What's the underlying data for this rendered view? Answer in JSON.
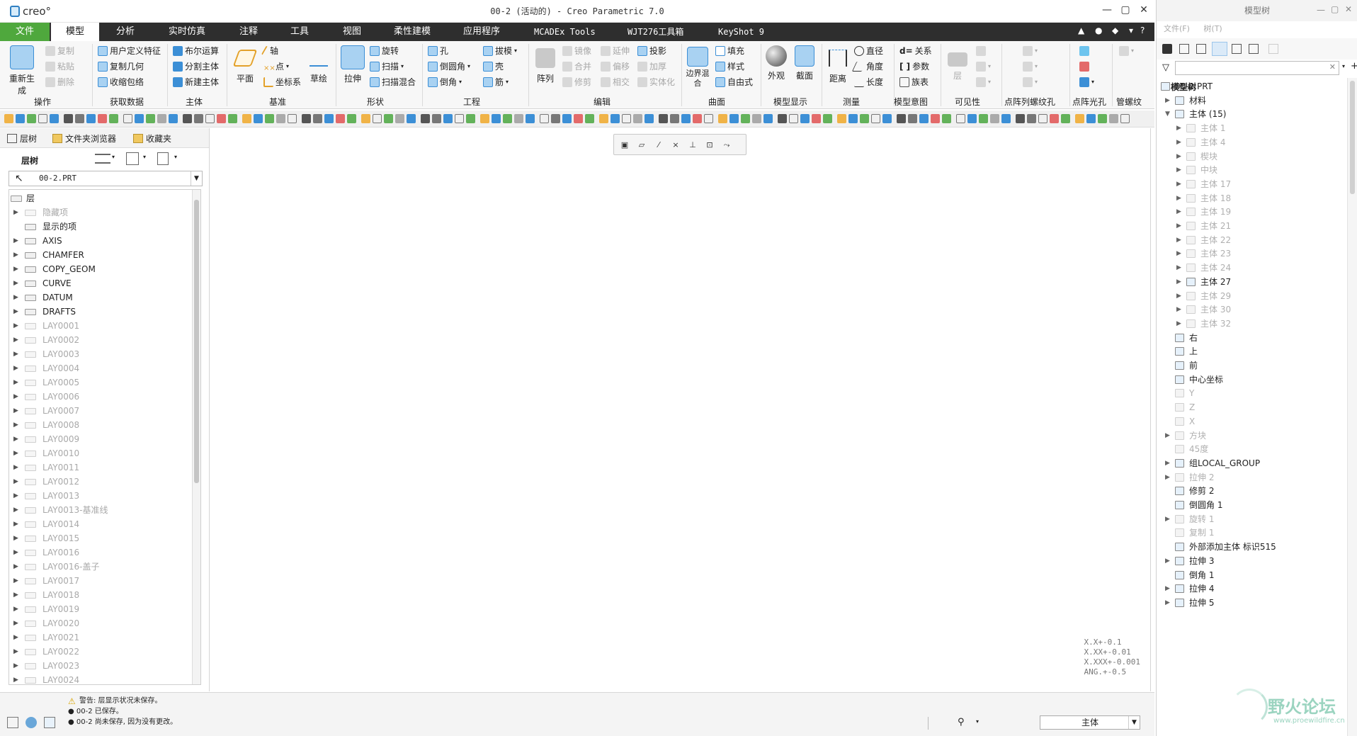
{
  "app": {
    "logo_text": "creo°",
    "window_title": "00-2 (活动的) - Creo Parametric 7.0"
  },
  "menu_tabs": [
    "文件",
    "模型",
    "分析",
    "实时仿真",
    "注释",
    "工具",
    "视图",
    "柔性建模",
    "应用程序",
    "MCADEx Tools",
    "WJT276工具箱",
    "KeyShot 9"
  ],
  "ribbon": {
    "groups": [
      "操作",
      "获取数据",
      "主体",
      "基准",
      "形状",
      "工程",
      "编辑",
      "曲面",
      "模型显示",
      "测量",
      "模型意图",
      "可见性",
      "点阵列螺纹孔",
      "点阵光孔",
      "管螺纹"
    ],
    "regenerate": "重新生成",
    "copy": "复制",
    "paste": "粘贴",
    "delete": "删除",
    "user_feature": "用户定义特征",
    "copy_geom": "复制几何",
    "shrinkwrap": "收缩包络",
    "boolean": "布尔运算",
    "split_body": "分割主体",
    "new_body": "新建主体",
    "plane": "平面",
    "axis": "轴",
    "point": "点",
    "csys": "坐标系",
    "sketch": "草绘",
    "extrude": "拉伸",
    "revolve": "旋转",
    "sweep": "扫描",
    "swept_blend": "扫描混合",
    "hole": "孔",
    "round": "倒圆角",
    "chamfer": "倒角",
    "draft": "拔模",
    "shell": "壳",
    "rib": "筋",
    "pattern": "阵列",
    "mirror": "镜像",
    "merge": "合并",
    "trim": "修剪",
    "extend": "延伸",
    "offset": "偏移",
    "intersect": "相交",
    "project": "投影",
    "thicken": "加厚",
    "solidify": "实体化",
    "boundary_blend": "边界混合",
    "fill": "填充",
    "style": "样式",
    "freestyle": "自由式",
    "appearance": "外观",
    "section": "截面",
    "distance": "距离",
    "diameter": "直径",
    "angle": "角度",
    "length": "长度",
    "relations": "关系",
    "parameters": "参数",
    "family_table": "族表",
    "layer": "层",
    "relations_prefix": "d="
  },
  "left_panel": {
    "tabs": [
      "层树",
      "文件夹浏览器",
      "收藏夹"
    ],
    "header": "层树",
    "selected_part": "00-2.PRT",
    "layers": [
      {
        "name": "层",
        "dim": false,
        "exp": false,
        "root": true
      },
      {
        "name": "隐藏项",
        "dim": true,
        "exp": true
      },
      {
        "name": "显示的项",
        "dim": false,
        "exp": false
      },
      {
        "name": "AXIS",
        "dim": false,
        "exp": true
      },
      {
        "name": "CHAMFER",
        "dim": false,
        "exp": true
      },
      {
        "name": "COPY_GEOM",
        "dim": false,
        "exp": true
      },
      {
        "name": "CURVE",
        "dim": false,
        "exp": true
      },
      {
        "name": "DATUM",
        "dim": false,
        "exp": true
      },
      {
        "name": "DRAFTS",
        "dim": false,
        "exp": true
      },
      {
        "name": "LAY0001",
        "dim": true,
        "exp": true
      },
      {
        "name": "LAY0002",
        "dim": true,
        "exp": true
      },
      {
        "name": "LAY0003",
        "dim": true,
        "exp": true
      },
      {
        "name": "LAY0004",
        "dim": true,
        "exp": true
      },
      {
        "name": "LAY0005",
        "dim": true,
        "exp": true
      },
      {
        "name": "LAY0006",
        "dim": true,
        "exp": true
      },
      {
        "name": "LAY0007",
        "dim": true,
        "exp": true
      },
      {
        "name": "LAY0008",
        "dim": true,
        "exp": true
      },
      {
        "name": "LAY0009",
        "dim": true,
        "exp": true
      },
      {
        "name": "LAY0010",
        "dim": true,
        "exp": true
      },
      {
        "name": "LAY0011",
        "dim": true,
        "exp": true
      },
      {
        "name": "LAY0012",
        "dim": true,
        "exp": true
      },
      {
        "name": "LAY0013",
        "dim": true,
        "exp": true
      },
      {
        "name": "LAY0013-基准线",
        "dim": true,
        "exp": true
      },
      {
        "name": "LAY0014",
        "dim": true,
        "exp": true
      },
      {
        "name": "LAY0015",
        "dim": true,
        "exp": true
      },
      {
        "name": "LAY0016",
        "dim": true,
        "exp": true
      },
      {
        "name": "LAY0016-盖子",
        "dim": true,
        "exp": true
      },
      {
        "name": "LAY0017",
        "dim": true,
        "exp": true
      },
      {
        "name": "LAY0018",
        "dim": true,
        "exp": true
      },
      {
        "name": "LAY0019",
        "dim": true,
        "exp": true
      },
      {
        "name": "LAY0020",
        "dim": true,
        "exp": true
      },
      {
        "name": "LAY0021",
        "dim": true,
        "exp": true
      },
      {
        "name": "LAY0022",
        "dim": true,
        "exp": true
      },
      {
        "name": "LAY0023",
        "dim": true,
        "exp": true
      },
      {
        "name": "LAY0024",
        "dim": true,
        "exp": true
      }
    ]
  },
  "graphics": {
    "tolerance_lines": [
      "X.X+-0.1",
      "X.XX+-0.01",
      "X.XXX+-0.001",
      "ANG.+-0.5"
    ]
  },
  "status": {
    "messages": [
      "警告: 层显示状况未保存。",
      "● 00-2 已保存。",
      "● 00-2 尚未保存, 因为没有更改。"
    ],
    "filter_value": "主体"
  },
  "model_tree": {
    "window_title": "模型树",
    "menu": [
      "文件(F)",
      "树(T)"
    ],
    "header": "模型树",
    "items": [
      {
        "name": "00-2.PRT",
        "level": 0,
        "exp": false,
        "dim": false
      },
      {
        "name": "材料",
        "level": 1,
        "exp": true,
        "dim": false
      },
      {
        "name": "主体 (15)",
        "level": 1,
        "exp": true,
        "dim": false,
        "open": true
      },
      {
        "name": "主体 1",
        "level": 2,
        "exp": true,
        "dim": true
      },
      {
        "name": "主体 4",
        "level": 2,
        "exp": true,
        "dim": true
      },
      {
        "name": "楔块",
        "level": 2,
        "exp": true,
        "dim": true
      },
      {
        "name": "中块",
        "level": 2,
        "exp": true,
        "dim": true
      },
      {
        "name": "主体 17",
        "level": 2,
        "exp": true,
        "dim": true
      },
      {
        "name": "主体 18",
        "level": 2,
        "exp": true,
        "dim": true
      },
      {
        "name": "主体 19",
        "level": 2,
        "exp": true,
        "dim": true
      },
      {
        "name": "主体 21",
        "level": 2,
        "exp": true,
        "dim": true
      },
      {
        "name": "主体 22",
        "level": 2,
        "exp": true,
        "dim": true
      },
      {
        "name": "主体 23",
        "level": 2,
        "exp": true,
        "dim": true
      },
      {
        "name": "主体 24",
        "level": 2,
        "exp": true,
        "dim": true
      },
      {
        "name": "主体 27",
        "level": 2,
        "exp": true,
        "dim": false
      },
      {
        "name": "主体 29",
        "level": 2,
        "exp": true,
        "dim": true
      },
      {
        "name": "主体 30",
        "level": 2,
        "exp": true,
        "dim": true
      },
      {
        "name": "主体 32",
        "level": 2,
        "exp": true,
        "dim": true
      },
      {
        "name": "右",
        "level": 1,
        "exp": false,
        "dim": false
      },
      {
        "name": "上",
        "level": 1,
        "exp": false,
        "dim": false
      },
      {
        "name": "前",
        "level": 1,
        "exp": false,
        "dim": false
      },
      {
        "name": "中心坐标",
        "level": 1,
        "exp": false,
        "dim": false
      },
      {
        "name": "Y",
        "level": 1,
        "exp": false,
        "dim": true
      },
      {
        "name": "Z",
        "level": 1,
        "exp": false,
        "dim": true
      },
      {
        "name": "X",
        "level": 1,
        "exp": false,
        "dim": true
      },
      {
        "name": "方块",
        "level": 1,
        "exp": true,
        "dim": true
      },
      {
        "name": "45度",
        "level": 1,
        "exp": false,
        "dim": true
      },
      {
        "name": "组LOCAL_GROUP",
        "level": 1,
        "exp": true,
        "dim": false
      },
      {
        "name": "拉伸 2",
        "level": 1,
        "exp": true,
        "dim": true
      },
      {
        "name": "修剪 2",
        "level": 1,
        "exp": false,
        "dim": false
      },
      {
        "name": "倒圆角 1",
        "level": 1,
        "exp": false,
        "dim": false
      },
      {
        "name": "旋转 1",
        "level": 1,
        "exp": true,
        "dim": true
      },
      {
        "name": "复制 1",
        "level": 1,
        "exp": false,
        "dim": true
      },
      {
        "name": "外部添加主体 标识515",
        "level": 1,
        "exp": false,
        "dim": false
      },
      {
        "name": "拉伸 3",
        "level": 1,
        "exp": true,
        "dim": false
      },
      {
        "name": "倒角 1",
        "level": 1,
        "exp": false,
        "dim": false
      },
      {
        "name": "拉伸 4",
        "level": 1,
        "exp": true,
        "dim": false
      },
      {
        "name": "拉伸 5",
        "level": 1,
        "exp": true,
        "dim": false
      }
    ]
  },
  "watermark": {
    "title": "野火论坛",
    "url": "www.proewildfire.cn"
  },
  "colors": {
    "file_tab": "#4fa83d",
    "tab_bar": "#2e2e2e",
    "accent": "#3c8fd6"
  }
}
